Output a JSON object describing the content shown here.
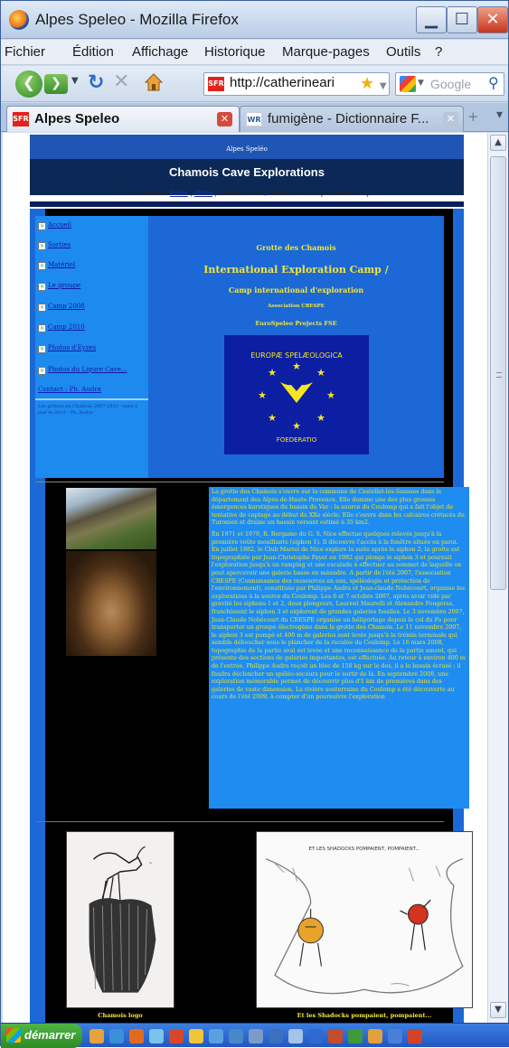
{
  "window": {
    "title": "Alpes Speleo - Mozilla Firefox"
  },
  "menu": [
    "Fichier",
    "Édition",
    "Affichage",
    "Historique",
    "Marque-pages",
    "Outils",
    "?"
  ],
  "toolbar": {
    "url": "http://catherineari",
    "search_placeholder": "Google",
    "back_glyph": "❮",
    "forward_glyph": "❯"
  },
  "tabs": [
    {
      "label": "Alpes Speleo",
      "favicon": "SFR",
      "active": true
    },
    {
      "label": "fumigène - Dictionnaire F...",
      "favicon": "WR",
      "active": false
    }
  ],
  "page": {
    "site_name": "Alpes Speléo",
    "heading": "Chamois Cave Explorations",
    "breadcrumb": {
      "prefix": "You are here :",
      "link1": "Index",
      "sep": "|",
      "link2": "Photo",
      "suffix": "| Chamois Cave, International Exploration Camp"
    },
    "nav": [
      "Accueil",
      "Sorties",
      "Matériel",
      "Le groupe",
      "Camp 2008",
      "Camp 2010",
      "Photos d'Eyzes",
      "Photos du Ligure Cave..."
    ],
    "contact": "Contact : Ph. Audra",
    "sidebar_note": "Les grottes du Chamois 2007-2010 - mise à jour le 2010 - Ph. Audra",
    "main": {
      "title": "Grotte des Chamois",
      "subtitle": "International Exploration Camp /",
      "subtitle2": "Camp international d'exploration",
      "assoc": "Association CRESPE",
      "projects": "EuroSpeleo Projects FSE"
    },
    "flag": {
      "top_text": "EUROPÆ SPELÆOLOGICA",
      "bottom_text": "FOEDERATIO"
    },
    "paragraph1": "La grotte des Chamois s'ouvre sur la commune de Castellet-lès-Sausses dans le département des Alpes-de-Haute-Provence. Elle domine une des plus grosses émergences karstiques du bassin du Var : la source du Coulomp qui a fait l'objet de tentative de captage au début du XXe siècle. Elle s'ouvre dans les calcaires crétacés du Turonien et draine un bassin versant estimé à 35 km2.",
    "paragraph2": "En 1971 et 1979, R. Bergamo du G. S. Nice effectue quelques relevés jusqu'à la première voûte mouillante (siphon 1). Il découvre l'accès à la fenêtre située en paroi. En juillet 1982, le Club Martel de Nice explore la suite après le siphon 2; la grotte est topographiée par Jean-Christophe Fayet en 1982 qui plonge le siphon 3 et poursuit l'exploration jusqu'à un ramping et une escalade à effectuer au sommet de laquelle on peut apercevoir une galerie basse en méandre. A partir de l'été 2007, l'association CRESPE (Connaissance des ressources en eau, spéléologie et protection de l'environnement), constituée par Philippe Audra et Jean-claude Nobécourt, organise les explorations à la source du Coulomp. Les 6 et 7 octobre 2007, après avoir vidé par gravité les siphons 1 et 2, deux plongeurs, Laurent Maurelli et Alexandre Fougeras, franchissent le siphon 3 et explorent de grandes galeries fossiles. Le 3 novembre 2007, Jean-Claude Nobécourt du CRESPE organise un héliportage depuis le col du Fa pour transporter un groupe électrogène dans la grotte des Chamois. Le 11 novembre 2007, le siphon 3 est pompé et 400 m de galeries sont levés jusqu'à la trémie terminale qui semble déboucher sous le plancher de la reculée du Coulomp. Le 16 mars 2008, topographie de la partie aval est levée et une reconnaissance de la partie amont, qui présente des sections de galeries importantes, est effectuée. Au retour à environ 400 m de l'entrée, Philippe Audra reçoit un bloc de 150 kg sur le dos, il a le bassin écrasé ; il faudra déclencher un spéléo-secours pour le sortir de là. En septembre 2008, une exploration mémorable permet de découvrir plus d'1 km de premières dans des galeries de vaste dimension. La rivière souterraine du Coulomp a été découverte au cours de l'été 2009, à compter d'un poursuivre l'exploration",
    "caption1": "Chamois logo",
    "caption2": "Et les Shadocks pompaient, pompaient...",
    "drawing2_text": "ET LES SHADOCKS POMPAIENT, POMPAIENT..."
  },
  "taskbar": {
    "start_label": "démarrer"
  },
  "colors": {
    "page_blue": "#1b68d6",
    "text_yellow": "#f3e43a",
    "header_navy": "#0a2d6e"
  }
}
